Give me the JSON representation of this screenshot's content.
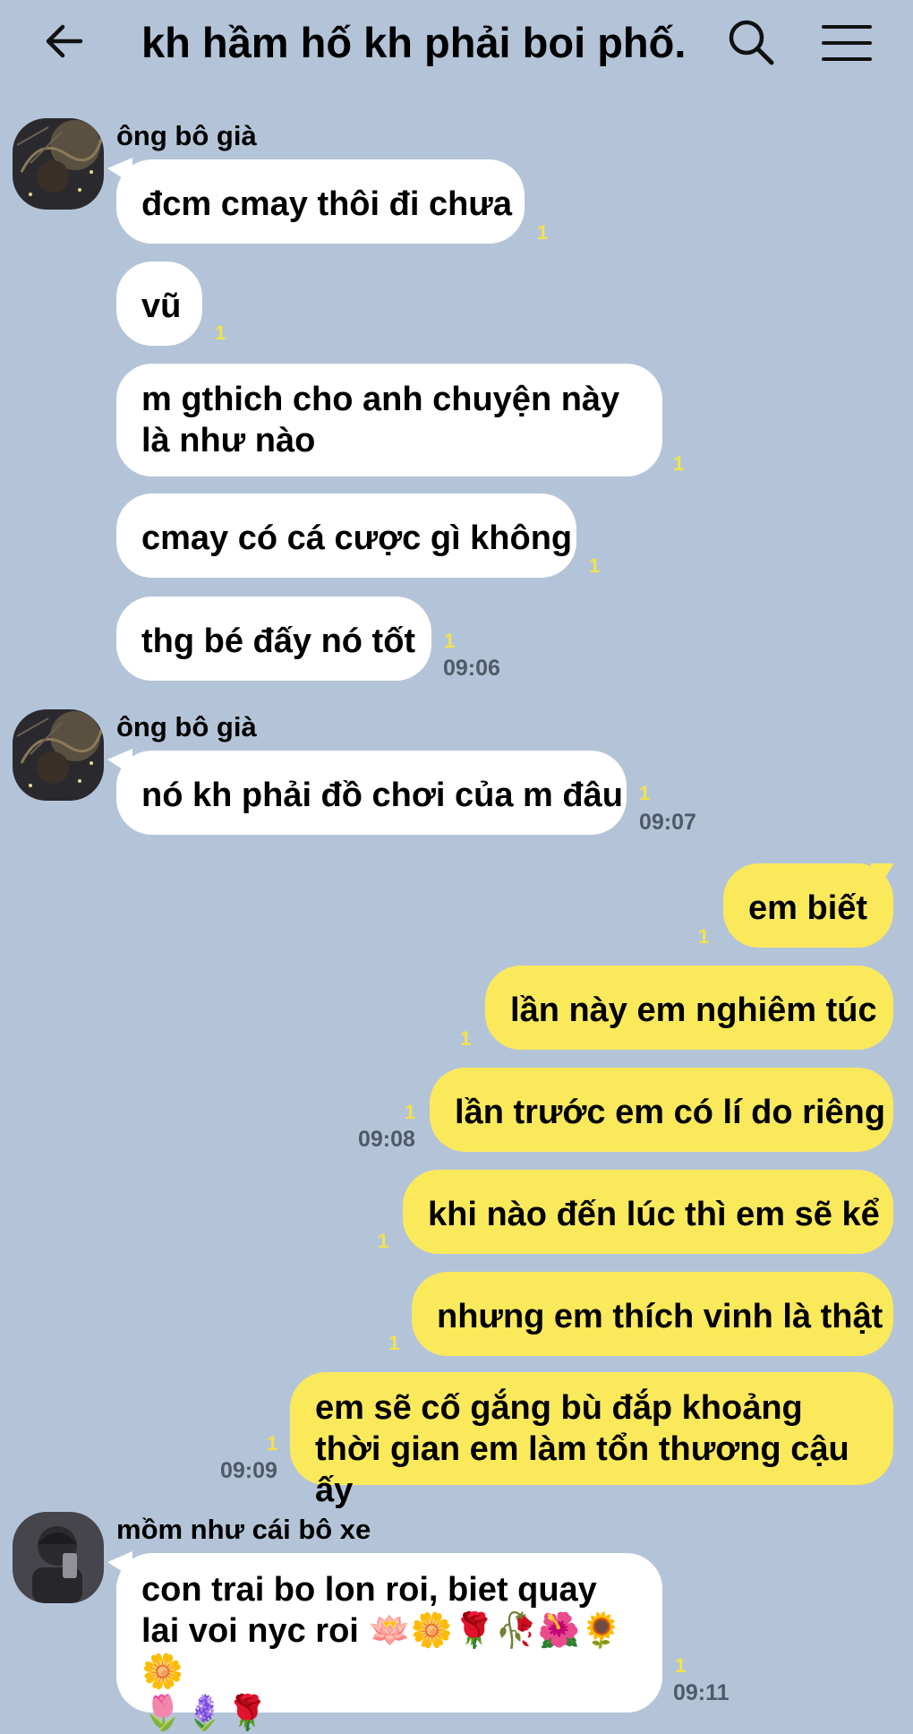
{
  "header": {
    "back_icon": "arrow-left-icon",
    "title": "kh hầm hố kh phải boi phố...",
    "search_icon": "search-icon",
    "menu_icon": "hamburger-menu-icon"
  },
  "messages": [
    {
      "sender": "ông bô già",
      "text": "đcm cmay thôi đi chưa",
      "read": "1"
    },
    {
      "text": "vũ",
      "read": "1"
    },
    {
      "text": "m gthich cho anh chuyện này là như nào",
      "read": "1"
    },
    {
      "text": "cmay có cá cược gì không",
      "read": "1"
    },
    {
      "text": "thg bé đấy nó tốt",
      "read": "1",
      "time": "09:06"
    },
    {
      "sender": "ông bô già",
      "text": "nó kh phải đồ chơi của m đâu",
      "read": "1",
      "time": "09:07"
    },
    {
      "text": "em biết",
      "read": "1"
    },
    {
      "text": "lần này em nghiêm túc",
      "read": "1"
    },
    {
      "text": "lần trước em có lí do riêng",
      "read": "1",
      "time": "09:08"
    },
    {
      "text": "khi nào đến lúc thì em sẽ kể",
      "read": "1"
    },
    {
      "text": "nhưng em thích vinh là thật",
      "read": "1"
    },
    {
      "text": "em sẽ cố gắng bù đắp khoảng thời gian em làm tổn thương cậu ấy",
      "read": "1",
      "time": "09:09"
    },
    {
      "sender": "mồm như cái bô xe",
      "text": "con trai bo lon roi, biet quay lai voi nyc roi",
      "emoji_line1": "🪷🌼🌹🥀🌺🌻🌼",
      "emoji_line2": "🌷🪻🌹",
      "read": "1",
      "time": "09:11"
    }
  ],
  "colors": {
    "background": "#b4c4d8",
    "incoming_bubble": "#ffffff",
    "outgoing_bubble": "#fbe95c",
    "read_count": "#f2e24a",
    "time": "#4f5a68"
  }
}
